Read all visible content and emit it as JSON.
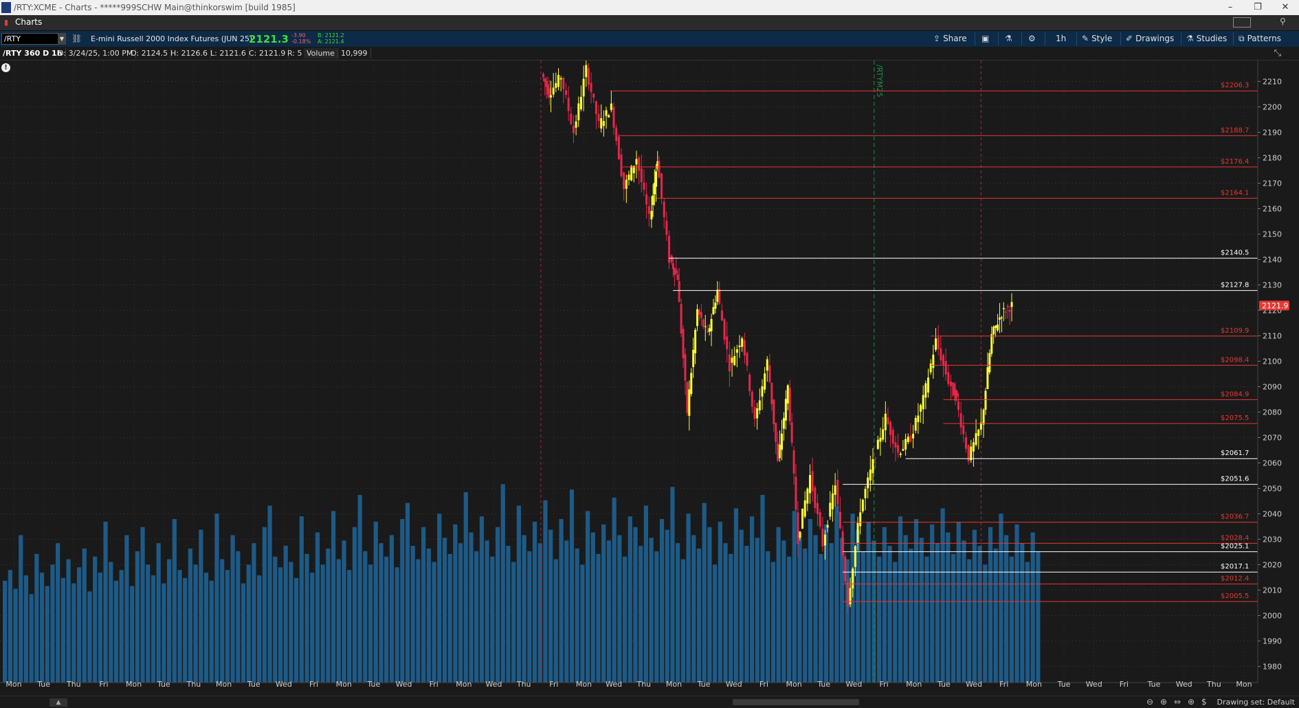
{
  "window": {
    "title": "/RTY:XCME - Charts - *****999SCHW Main@thinkorswim [build 1985]",
    "minimize": "–",
    "maximize": "❐",
    "close": "✕"
  },
  "tabbar": {
    "tab_label": "Charts",
    "pin_glyph": "⚲"
  },
  "toolbar": {
    "symbol": "/RTY",
    "instrument_name": "E-mini Russell 2000 Index Futures (JUN 25)",
    "last_price": "2121.3",
    "net_change": "-3.90",
    "pct_change": "-0.18%",
    "bid": "B: 2121.2",
    "ask": "A: 2121.4",
    "share_label": "Share",
    "aggregation": "1h",
    "style_label": "Style",
    "drawings_label": "Drawings",
    "studies_label": "Studies",
    "patterns_label": "Patterns"
  },
  "infobar": {
    "chart_desc": "/RTY 360 D 1h",
    "date": "D: 3/24/25, 1:00 PM",
    "open": "O: 2124.5",
    "high": "H: 2126.6",
    "low": "L: 2121.6",
    "close": "C: 2121.9",
    "range": "R: 5",
    "volume_label": "Volume",
    "volume_value": "10,999"
  },
  "chart_data": {
    "type": "candlestick",
    "symbol": "/RTY",
    "ylim": [
      1975,
      2215
    ],
    "y_ticks": [
      1980,
      1990,
      2000,
      2010,
      2020,
      2030,
      2040,
      2050,
      2060,
      2070,
      2080,
      2090,
      2100,
      2110,
      2120,
      2130,
      2140,
      2150,
      2160,
      2170,
      2180,
      2190,
      2200,
      2210
    ],
    "current_price_label": "2121.9",
    "contract_roll_label": "/RTYM25",
    "x_labels": [
      {
        "label": "Mon",
        "slot": 0
      },
      {
        "label": "Tue",
        "slot": 1
      },
      {
        "label": "Thu",
        "slot": 2
      },
      {
        "label": "Fri",
        "slot": 3
      },
      {
        "label": "Mon",
        "slot": 4
      },
      {
        "label": "Tue",
        "slot": 5
      },
      {
        "label": "Thu",
        "slot": 6
      },
      {
        "label": "Mon",
        "slot": 7
      },
      {
        "label": "Tue",
        "slot": 8
      },
      {
        "label": "Wed",
        "slot": 9
      },
      {
        "label": "Fri",
        "slot": 10
      },
      {
        "label": "Mon",
        "slot": 11
      },
      {
        "label": "Tue",
        "slot": 12
      },
      {
        "label": "Wed",
        "slot": 13
      },
      {
        "label": "Fri",
        "slot": 14
      },
      {
        "label": "Mon",
        "slot": 15
      },
      {
        "label": "Wed",
        "slot": 16
      },
      {
        "label": "Thu",
        "slot": 17
      },
      {
        "label": "Fri",
        "slot": 18
      },
      {
        "label": "Mon",
        "slot": 19
      },
      {
        "label": "Wed",
        "slot": 20
      },
      {
        "label": "Thu",
        "slot": 21
      },
      {
        "label": "Mon",
        "slot": 22
      },
      {
        "label": "Tue",
        "slot": 23
      },
      {
        "label": "Wed",
        "slot": 24
      },
      {
        "label": "Fri",
        "slot": 25
      },
      {
        "label": "Mon",
        "slot": 26
      },
      {
        "label": "Tue",
        "slot": 27
      },
      {
        "label": "Wed",
        "slot": 28
      },
      {
        "label": "Fri",
        "slot": 29
      },
      {
        "label": "Mon",
        "slot": 30
      },
      {
        "label": "Tue",
        "slot": 31
      },
      {
        "label": "Wed",
        "slot": 32
      },
      {
        "label": "Fri",
        "slot": 33
      },
      {
        "label": "Mon",
        "slot": 34
      },
      {
        "label": "Tue",
        "slot": 35
      },
      {
        "label": "Wed",
        "slot": 36
      },
      {
        "label": "Fri",
        "slot": 37
      },
      {
        "label": "Tue",
        "slot": 38
      },
      {
        "label": "Wed",
        "slot": 39
      },
      {
        "label": "Thu",
        "slot": 40
      },
      {
        "label": "Mon",
        "slot": 41
      }
    ],
    "levels": [
      {
        "price": 2206.3,
        "label": "$2206.3",
        "color": "#e53935"
      },
      {
        "price": 2188.7,
        "label": "$2188.7",
        "color": "#e53935"
      },
      {
        "price": 2176.4,
        "label": "$2176.4",
        "color": "#e53935"
      },
      {
        "price": 2164.1,
        "label": "$2164.1",
        "color": "#e53935"
      },
      {
        "price": 2140.5,
        "label": "$2140.5",
        "color": "#ffffff"
      },
      {
        "price": 2127.8,
        "label": "$2127.8",
        "color": "#ffffff"
      },
      {
        "price": 2109.9,
        "label": "$2109.9",
        "color": "#e53935"
      },
      {
        "price": 2098.4,
        "label": "$2098.4",
        "color": "#e53935"
      },
      {
        "price": 2084.9,
        "label": "$2084.9",
        "color": "#e53935"
      },
      {
        "price": 2075.5,
        "label": "$2075.5",
        "color": "#e53935"
      },
      {
        "price": 2061.7,
        "label": "$2061.7",
        "color": "#ffffff"
      },
      {
        "price": 2051.6,
        "label": "$2051.6",
        "color": "#ffffff"
      },
      {
        "price": 2036.7,
        "label": "$2036.7",
        "color": "#e53935"
      },
      {
        "price": 2028.4,
        "label": "$2028.4",
        "color": "#e53935"
      },
      {
        "price": 2025.1,
        "label": "$2025.1",
        "color": "#ffffff"
      },
      {
        "price": 2017.1,
        "label": "$2017.1",
        "color": "#ffffff"
      },
      {
        "price": 2012.4,
        "label": "$2012.4",
        "color": "#e53935"
      },
      {
        "price": 2005.5,
        "label": "$2005.5",
        "color": "#e53935"
      }
    ],
    "price_path": [
      [
        0.432,
        2213
      ],
      [
        0.438,
        2205
      ],
      [
        0.448,
        2212
      ],
      [
        0.458,
        2190
      ],
      [
        0.468,
        2215
      ],
      [
        0.478,
        2193
      ],
      [
        0.488,
        2200
      ],
      [
        0.498,
        2168
      ],
      [
        0.508,
        2180
      ],
      [
        0.518,
        2156
      ],
      [
        0.524,
        2180
      ],
      [
        0.534,
        2140
      ],
      [
        0.54,
        2133
      ],
      [
        0.548,
        2080
      ],
      [
        0.556,
        2120
      ],
      [
        0.564,
        2110
      ],
      [
        0.572,
        2128
      ],
      [
        0.582,
        2098
      ],
      [
        0.592,
        2110
      ],
      [
        0.602,
        2076
      ],
      [
        0.612,
        2100
      ],
      [
        0.62,
        2060
      ],
      [
        0.628,
        2090
      ],
      [
        0.636,
        2030
      ],
      [
        0.646,
        2055
      ],
      [
        0.656,
        2028
      ],
      [
        0.666,
        2052
      ],
      [
        0.676,
        2005
      ],
      [
        0.686,
        2042
      ],
      [
        0.696,
        2060
      ],
      [
        0.706,
        2078
      ],
      [
        0.716,
        2064
      ],
      [
        0.726,
        2070
      ],
      [
        0.736,
        2085
      ],
      [
        0.746,
        2108
      ],
      [
        0.756,
        2092
      ],
      [
        0.762,
        2085
      ],
      [
        0.772,
        2062
      ],
      [
        0.782,
        2075
      ],
      [
        0.79,
        2110
      ],
      [
        0.798,
        2119
      ],
      [
        0.806,
        2122
      ]
    ],
    "volume_max": 100,
    "volume": [
      38,
      42,
      35,
      55,
      40,
      33,
      48,
      41,
      36,
      44,
      52,
      39,
      46,
      37,
      43,
      50,
      34,
      47,
      41,
      60,
      45,
      38,
      42,
      55,
      36,
      49,
      58,
      44,
      40,
      52,
      37,
      46,
      61,
      42,
      39,
      50,
      44,
      57,
      41,
      38,
      63,
      46,
      42,
      55,
      49,
      37,
      44,
      52,
      40,
      58,
      66,
      47,
      43,
      51,
      45,
      39,
      62,
      48,
      41,
      56,
      44,
      50,
      64,
      46,
      53,
      42,
      58,
      70,
      49,
      44,
      60,
      52,
      47,
      55,
      43,
      61,
      67,
      51,
      46,
      58,
      50,
      45,
      63,
      54,
      48,
      59,
      52,
      71,
      56,
      49,
      62,
      53,
      47,
      58,
      74,
      51,
      45,
      66,
      55,
      49,
      60,
      52,
      68,
      57,
      46,
      61,
      53,
      72,
      50,
      44,
      64,
      56,
      48,
      59,
      53,
      69,
      55,
      47,
      62,
      58,
      51,
      66,
      54,
      49,
      61,
      57,
      73,
      52,
      46,
      63,
      55,
      50,
      67,
      58,
      44,
      60,
      52,
      48,
      65,
      57,
      51,
      62,
      54,
      70,
      49,
      45,
      58,
      53,
      47,
      64,
      56,
      50,
      61,
      55,
      48,
      59,
      52,
      66,
      54,
      46,
      63,
      57,
      49,
      60,
      53,
      47,
      58,
      51,
      45,
      62,
      55,
      50,
      61,
      54,
      47,
      59,
      52,
      65,
      56,
      48,
      60,
      53,
      46,
      57,
      51,
      44,
      58,
      50,
      63,
      55,
      47,
      59,
      52,
      45,
      56,
      49
    ],
    "grid": true
  },
  "bottombar": {
    "collapse_glyph": "▲",
    "drawing_set": "Drawing set: Default",
    "zoom_out": "⊖",
    "zoom_in": "⊕",
    "pan": "⇔",
    "crosshair": "⊕",
    "price_ctl": "$"
  },
  "colors": {
    "up_candle": "#ffff33",
    "down_candle": "#e8264a",
    "volume_bar": "#1e5a86",
    "toolbar_bg": "#0d2a47",
    "price_bubble": "#e53935"
  }
}
